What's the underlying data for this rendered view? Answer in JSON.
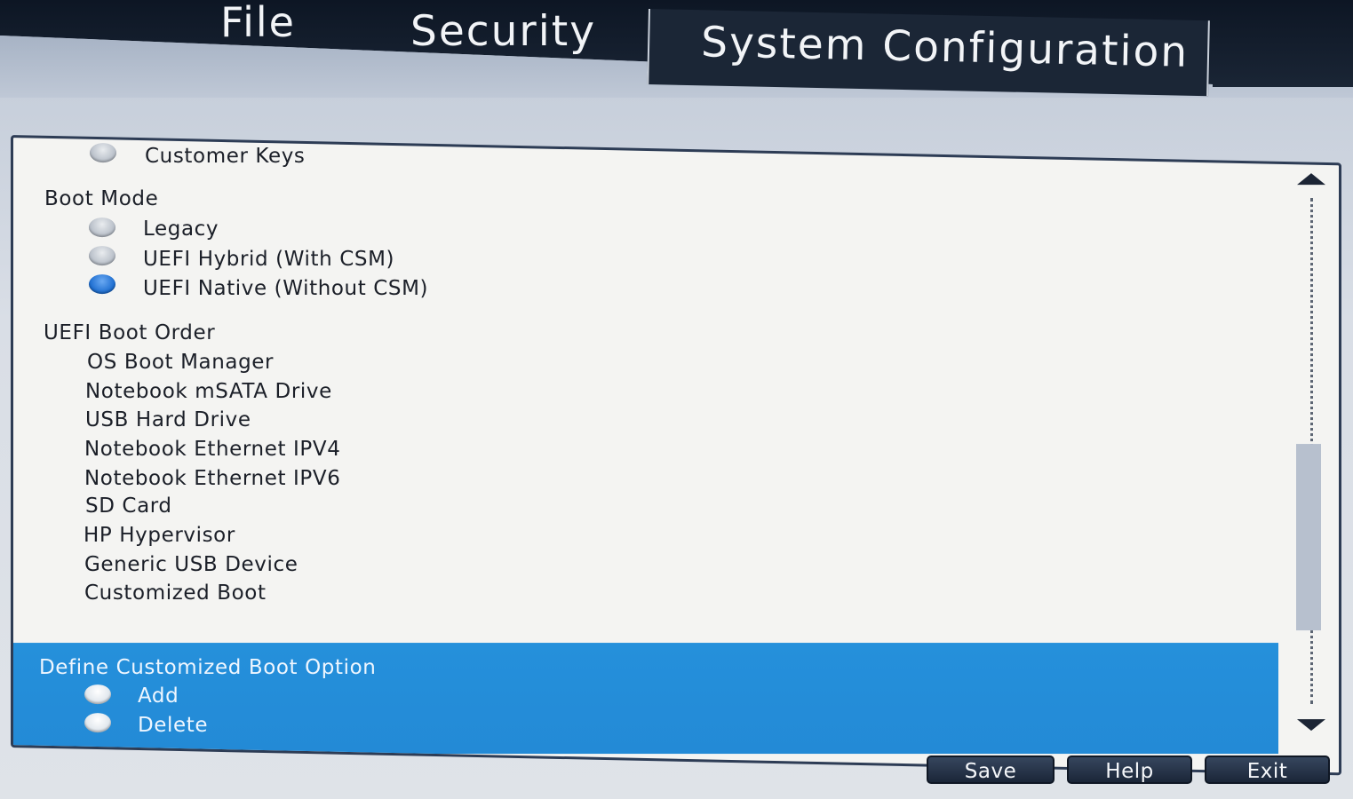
{
  "menu": {
    "file": "File",
    "security": "Security",
    "system_configuration": "System Configuration"
  },
  "options": {
    "customer_keys": "Customer Keys"
  },
  "boot_mode": {
    "heading": "Boot Mode",
    "legacy": "Legacy",
    "uefi_hybrid": "UEFI Hybrid (With CSM)",
    "uefi_native": "UEFI Native (Without CSM)",
    "selected": "UEFI Native (Without CSM)"
  },
  "uefi_boot_order": {
    "heading": "UEFI Boot Order",
    "items": [
      "OS Boot Manager",
      "Notebook mSATA Drive",
      "USB Hard Drive",
      "Notebook Ethernet IPV4",
      "Notebook Ethernet IPV6",
      "SD Card",
      "HP Hypervisor",
      "Generic USB Device",
      "Customized Boot"
    ]
  },
  "custom_boot": {
    "heading": "Define Customized Boot Option",
    "add": "Add",
    "delete": "Delete"
  },
  "buttons": {
    "save": "Save",
    "help": "Help",
    "exit": "Exit"
  },
  "colors": {
    "highlight": "#238ad6",
    "radio_selected": "#1f6fd1",
    "header_dark": "#0d1624"
  }
}
